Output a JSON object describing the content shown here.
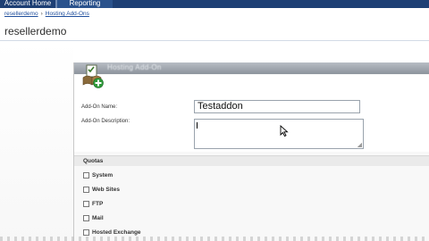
{
  "nav": {
    "tabs": [
      {
        "label": "Account Home"
      },
      {
        "label": "Reporting"
      }
    ]
  },
  "breadcrumb": {
    "items": [
      "resellerdemo",
      "Hosting Add-Ons"
    ],
    "separator": "›"
  },
  "page": {
    "title": "resellerdemo"
  },
  "panel": {
    "title": "Hosting Add-On"
  },
  "form": {
    "name_label": "Add-On Name:",
    "name_value": "Testaddon",
    "description_label": "Add-On Description:",
    "description_value": ""
  },
  "quotas": {
    "heading": "Quotas",
    "items": [
      {
        "label": "System",
        "checked": false
      },
      {
        "label": "Web Sites",
        "checked": false
      },
      {
        "label": "FTP",
        "checked": false
      },
      {
        "label": "Mail",
        "checked": false
      },
      {
        "label": "Hosted Exchange",
        "checked": false
      }
    ]
  },
  "colors": {
    "nav_bar": "#1d3f74",
    "link": "#1f4e9c",
    "panel_header": "#8c939c"
  }
}
